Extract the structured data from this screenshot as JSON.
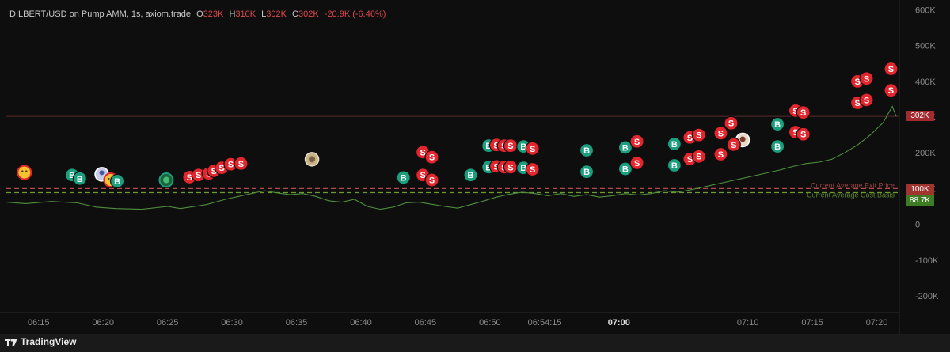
{
  "header": {
    "symbol": "DILBERT/USD on Pump AMM, 1s, axiom.trade",
    "o_label": "O",
    "o_value": "323K",
    "h_label": "H",
    "h_value": "310K",
    "l_label": "L",
    "l_value": "302K",
    "c_label": "C",
    "c_value": "302K",
    "change": "-20.9K (-6.46%)"
  },
  "footer": {
    "brand": "TradingView"
  },
  "price_tags": {
    "last": "302K",
    "exit": "100K",
    "cost": "88.7K"
  },
  "lines": {
    "exit_label": "Current Average Exit Price",
    "cost_label": "Current Average Cost Basis"
  },
  "colors": {
    "bg": "#0e0e0e",
    "buy": "#1a9e7e",
    "sell": "#e3262e",
    "line": "#4f8f3e",
    "exit_line": "#b04a4a",
    "cost_line": "#6b9a33",
    "axis_text": "#8a8a8a"
  },
  "chart_data": {
    "type": "line",
    "y_ticks": [
      "600K",
      "500K",
      "400K",
      "300K",
      "200K",
      "100K",
      "0",
      "-100K",
      "-200K"
    ],
    "y_tick_values": [
      600000,
      500000,
      400000,
      300000,
      200000,
      100000,
      0,
      -100000,
      -200000
    ],
    "ylim": [
      -240000,
      610000
    ],
    "x_ticks": [
      "06:15",
      "06:20",
      "06:25",
      "06:30",
      "06:35",
      "06:40",
      "06:45",
      "06:50",
      "06:54:15",
      "07:00",
      "07:10",
      "07:15",
      "07:20"
    ],
    "x_tick_minutes": [
      15,
      20,
      25,
      30,
      35,
      40,
      45,
      50,
      54.25,
      60,
      70,
      75,
      80
    ],
    "xlim": [
      12.5,
      81.5
    ],
    "bold_ticks": [
      "07:00"
    ],
    "reference_lines": [
      {
        "label": "Current Average Exit Price",
        "value": 100000
      },
      {
        "label": "Current Average Cost Basis",
        "value": 88700
      }
    ],
    "last_value": 302000,
    "series": [
      {
        "values": [
          [
            12.5,
            62000
          ],
          [
            14,
            58000
          ],
          [
            16,
            64000
          ],
          [
            18,
            60000
          ],
          [
            19.5,
            48000
          ],
          [
            21,
            44000
          ],
          [
            23,
            42000
          ],
          [
            25,
            50000
          ],
          [
            26,
            44000
          ],
          [
            28,
            55000
          ],
          [
            29.5,
            70000
          ],
          [
            30.5,
            78000
          ],
          [
            31.5,
            86000
          ],
          [
            32.5,
            94000
          ],
          [
            33.5,
            88000
          ],
          [
            34.5,
            83000
          ],
          [
            35.5,
            86000
          ],
          [
            36.5,
            78000
          ],
          [
            37.5,
            66000
          ],
          [
            38.5,
            62000
          ],
          [
            39.5,
            70000
          ],
          [
            40.5,
            50000
          ],
          [
            41.5,
            42000
          ],
          [
            42.5,
            48000
          ],
          [
            43.5,
            60000
          ],
          [
            44.5,
            62000
          ],
          [
            45.5,
            56000
          ],
          [
            46.5,
            50000
          ],
          [
            47.5,
            45000
          ],
          [
            48.5,
            55000
          ],
          [
            49.5,
            65000
          ],
          [
            50.5,
            76000
          ],
          [
            51.5,
            84000
          ],
          [
            52.5,
            90000
          ],
          [
            53.5,
            86000
          ],
          [
            54.5,
            80000
          ],
          [
            55.5,
            86000
          ],
          [
            56.5,
            78000
          ],
          [
            57.5,
            83000
          ],
          [
            58.5,
            76000
          ],
          [
            59.5,
            80000
          ],
          [
            60.5,
            86000
          ],
          [
            61.5,
            82000
          ],
          [
            62.5,
            86000
          ],
          [
            63.5,
            94000
          ],
          [
            64.5,
            90000
          ],
          [
            65.5,
            96000
          ],
          [
            66.5,
            104000
          ],
          [
            67.5,
            112000
          ],
          [
            68.5,
            120000
          ],
          [
            69.5,
            128000
          ],
          [
            70.5,
            136000
          ],
          [
            71.5,
            144000
          ],
          [
            72.5,
            152000
          ],
          [
            73.5,
            162000
          ],
          [
            74.5,
            170000
          ],
          [
            75.5,
            174000
          ],
          [
            76.5,
            182000
          ],
          [
            77.5,
            200000
          ],
          [
            78.5,
            222000
          ],
          [
            79.5,
            250000
          ],
          [
            80.5,
            285000
          ],
          [
            81.2,
            330000
          ],
          [
            81.5,
            302000
          ]
        ]
      }
    ],
    "markers": [
      {
        "t": 13.9,
        "v": 145000,
        "type": "emoji"
      },
      {
        "t": 17.6,
        "v": 138000,
        "type": "B"
      },
      {
        "t": 18.2,
        "v": 128000,
        "type": "B"
      },
      {
        "t": 19.9,
        "v": 140000,
        "type": "avatar"
      },
      {
        "t": 20.6,
        "v": 124000,
        "type": "emoji"
      },
      {
        "t": 21.1,
        "v": 121000,
        "type": "B"
      },
      {
        "t": 24.9,
        "v": 124000,
        "type": "frog"
      },
      {
        "t": 26.7,
        "v": 132000,
        "type": "S"
      },
      {
        "t": 27.4,
        "v": 138000,
        "type": "S"
      },
      {
        "t": 28.2,
        "v": 142000,
        "type": "S"
      },
      {
        "t": 28.6,
        "v": 150000,
        "type": "S"
      },
      {
        "t": 29.2,
        "v": 158000,
        "type": "S"
      },
      {
        "t": 29.9,
        "v": 168000,
        "type": "S"
      },
      {
        "t": 30.7,
        "v": 170000,
        "type": "S"
      },
      {
        "t": 36.2,
        "v": 182000,
        "type": "cat"
      },
      {
        "t": 43.3,
        "v": 131000,
        "type": "B"
      },
      {
        "t": 44.8,
        "v": 202000,
        "type": "S"
      },
      {
        "t": 45.5,
        "v": 188000,
        "type": "S"
      },
      {
        "t": 44.8,
        "v": 138000,
        "type": "S"
      },
      {
        "t": 45.5,
        "v": 124000,
        "type": "S"
      },
      {
        "t": 48.5,
        "v": 138000,
        "type": "B"
      },
      {
        "t": 49.9,
        "v": 220000,
        "type": "B"
      },
      {
        "t": 50.5,
        "v": 222000,
        "type": "S"
      },
      {
        "t": 51.1,
        "v": 220000,
        "type": "S"
      },
      {
        "t": 51.6,
        "v": 220000,
        "type": "S"
      },
      {
        "t": 52.6,
        "v": 218000,
        "type": "B"
      },
      {
        "t": 53.3,
        "v": 212000,
        "type": "S"
      },
      {
        "t": 49.9,
        "v": 160000,
        "type": "B"
      },
      {
        "t": 50.5,
        "v": 162000,
        "type": "S"
      },
      {
        "t": 51.1,
        "v": 160000,
        "type": "S"
      },
      {
        "t": 51.6,
        "v": 160000,
        "type": "S"
      },
      {
        "t": 52.6,
        "v": 158000,
        "type": "B"
      },
      {
        "t": 53.3,
        "v": 154000,
        "type": "S"
      },
      {
        "t": 57.5,
        "v": 207000,
        "type": "B"
      },
      {
        "t": 57.5,
        "v": 147000,
        "type": "B"
      },
      {
        "t": 60.5,
        "v": 215000,
        "type": "B"
      },
      {
        "t": 61.4,
        "v": 232000,
        "type": "S"
      },
      {
        "t": 60.5,
        "v": 155000,
        "type": "B"
      },
      {
        "t": 61.4,
        "v": 172000,
        "type": "S"
      },
      {
        "t": 64.3,
        "v": 225000,
        "type": "B"
      },
      {
        "t": 65.5,
        "v": 243000,
        "type": "S"
      },
      {
        "t": 66.2,
        "v": 250000,
        "type": "S"
      },
      {
        "t": 64.3,
        "v": 165000,
        "type": "B"
      },
      {
        "t": 65.5,
        "v": 183000,
        "type": "S"
      },
      {
        "t": 66.2,
        "v": 190000,
        "type": "S"
      },
      {
        "t": 67.9,
        "v": 255000,
        "type": "S"
      },
      {
        "t": 68.7,
        "v": 283000,
        "type": "S"
      },
      {
        "t": 67.9,
        "v": 196000,
        "type": "S"
      },
      {
        "t": 69.6,
        "v": 236000,
        "type": "avatar2"
      },
      {
        "t": 68.9,
        "v": 223000,
        "type": "S"
      },
      {
        "t": 72.3,
        "v": 280000,
        "type": "B"
      },
      {
        "t": 72.3,
        "v": 218000,
        "type": "B"
      },
      {
        "t": 73.7,
        "v": 318000,
        "type": "S"
      },
      {
        "t": 74.3,
        "v": 313000,
        "type": "S"
      },
      {
        "t": 73.7,
        "v": 258000,
        "type": "S"
      },
      {
        "t": 74.3,
        "v": 252000,
        "type": "S"
      },
      {
        "t": 78.5,
        "v": 400000,
        "type": "S"
      },
      {
        "t": 79.2,
        "v": 408000,
        "type": "S"
      },
      {
        "t": 78.5,
        "v": 340000,
        "type": "S"
      },
      {
        "t": 79.2,
        "v": 348000,
        "type": "S"
      },
      {
        "t": 81.1,
        "v": 435000,
        "type": "S"
      },
      {
        "t": 81.1,
        "v": 375000,
        "type": "S"
      }
    ]
  }
}
